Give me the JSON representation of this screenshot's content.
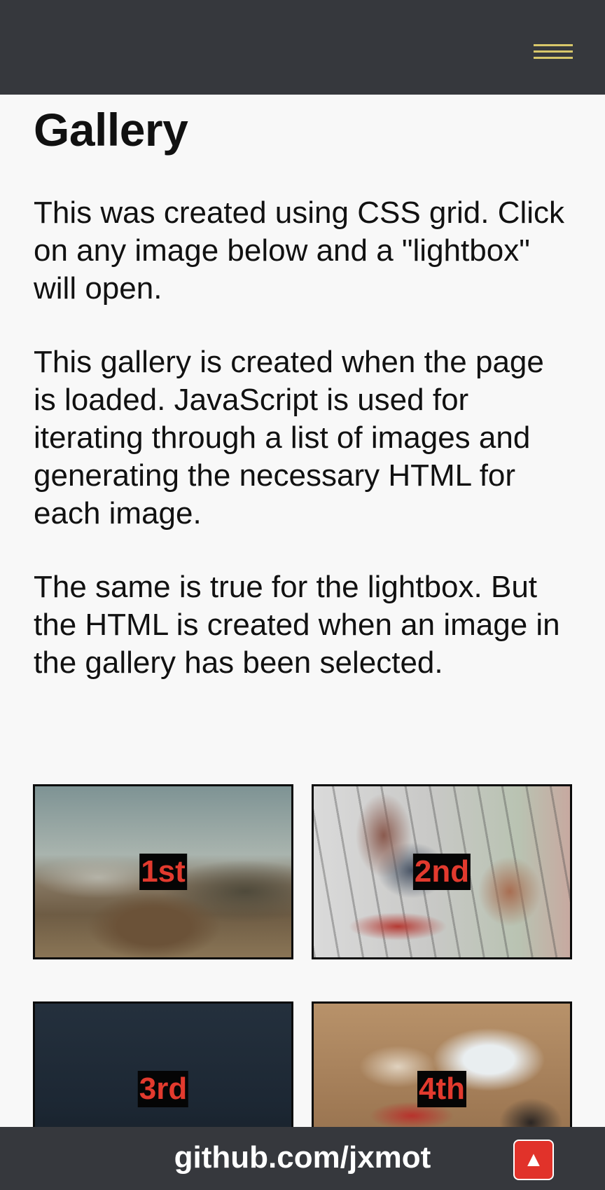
{
  "header": {
    "menu_icon": "hamburger-menu-icon",
    "accent_color": "#d8c76a",
    "background_color": "#36383d"
  },
  "main": {
    "title": "Gallery",
    "paragraphs": [
      "This was created using CSS grid. Click on any image below and a \"lightbox\" will open.",
      "This gallery is created when the page is loaded. JavaScript is used for iterating through a list of images and generating the necessary HTML for each image.",
      "The same is true for the lightbox. But the HTML is created when an image in the gallery has been selected."
    ]
  },
  "gallery": {
    "items": [
      {
        "label": "1st"
      },
      {
        "label": "2nd"
      },
      {
        "label": "3rd"
      },
      {
        "label": "4th"
      }
    ],
    "label_color": "#e23a2e"
  },
  "footer": {
    "link_text": "github.com/jxmot",
    "to_top_icon": "▲",
    "to_top_color": "#e1322a"
  }
}
